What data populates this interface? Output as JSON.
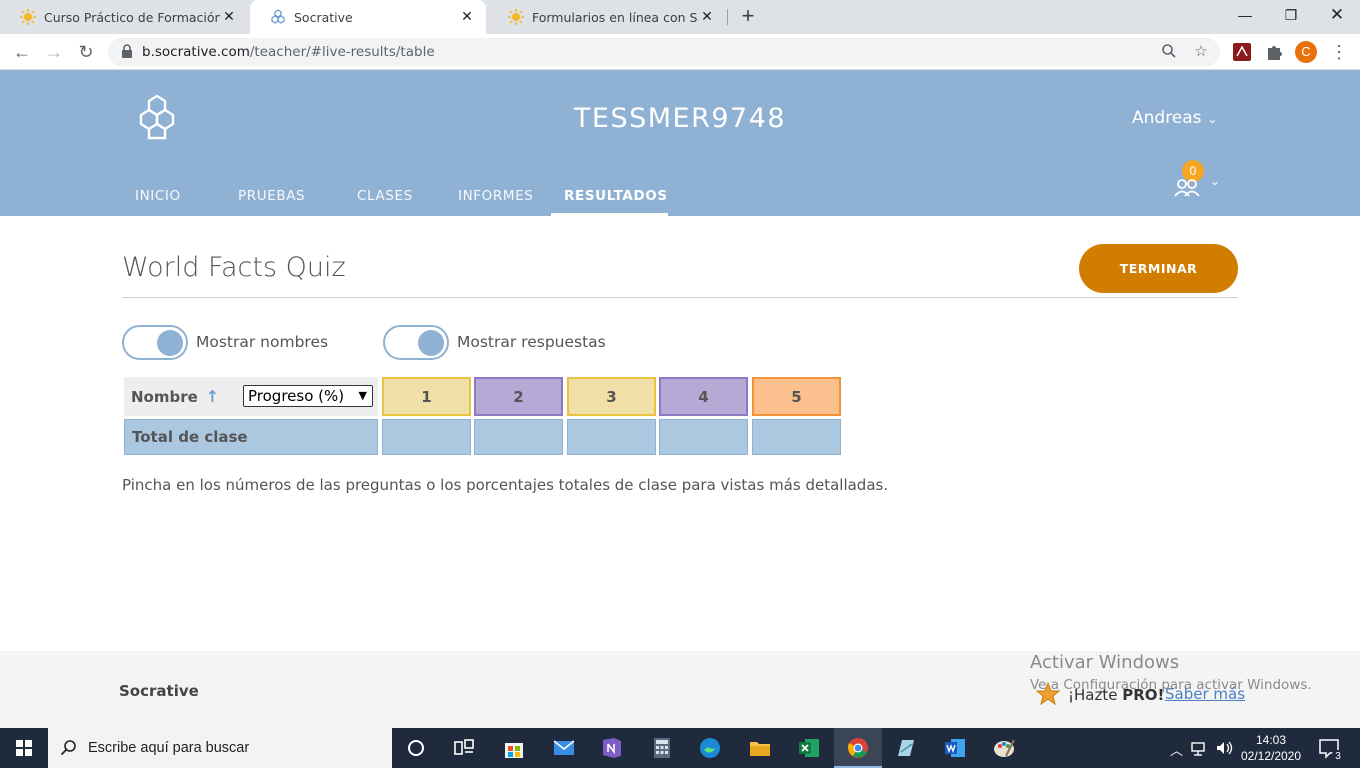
{
  "browser": {
    "tabs": [
      {
        "title": "Curso Práctico de Formación de Pr"
      },
      {
        "title": "Socrative"
      },
      {
        "title": "Formularios en línea con SOCRATIVE"
      }
    ],
    "new_tab": "+",
    "url_host": "b.socrative.com",
    "url_path": "/teacher/#live-results/table",
    "profile_initial": "C"
  },
  "header": {
    "room_name": "TESSMER9748",
    "user_name": "Andreas",
    "student_count": "0",
    "nav": [
      {
        "label": "INICIO"
      },
      {
        "label": "PRUEBAS"
      },
      {
        "label": "CLASES"
      },
      {
        "label": "INFORMES"
      },
      {
        "label": "RESULTADOS"
      }
    ]
  },
  "main": {
    "quiz_title": "World Facts Quiz",
    "end_button": "TERMINAR",
    "toggles": [
      {
        "label": "Mostrar nombres",
        "on": true
      },
      {
        "label": "Mostrar respuestas",
        "on": true
      }
    ],
    "table": {
      "name_header": "Nombre",
      "sort_arrow": "↑",
      "metric_select": "Progreso (%)",
      "questions": [
        "1",
        "2",
        "3",
        "4",
        "5"
      ],
      "question_colors": [
        "yellow",
        "purple",
        "yellow",
        "purple",
        "orange"
      ],
      "total_row_label": "Total de clase"
    },
    "hint": "Pincha en los números de las preguntas o los porcentajes totales de clase para vistas más detalladas."
  },
  "footer": {
    "brand": "Socrative",
    "pro_text_prefix": "¡Hazte ",
    "pro_text_bold": "PRO!",
    "pro_link": "Saber más",
    "watermark_line1": "Activar Windows",
    "watermark_line2": "Ve a Configuración para activar Windows."
  },
  "taskbar": {
    "search_placeholder": "Escribe aquí para buscar",
    "time": "14:03",
    "date": "02/12/2020",
    "notifications": "3"
  },
  "colors": {
    "header_bg": "#8fb1d3",
    "end_button": "#d07d00",
    "q_yellow": "#f1e1a8",
    "q_purple": "#b7a9d6",
    "q_orange": "#fcc08f",
    "total_row": "#abc8e0"
  }
}
